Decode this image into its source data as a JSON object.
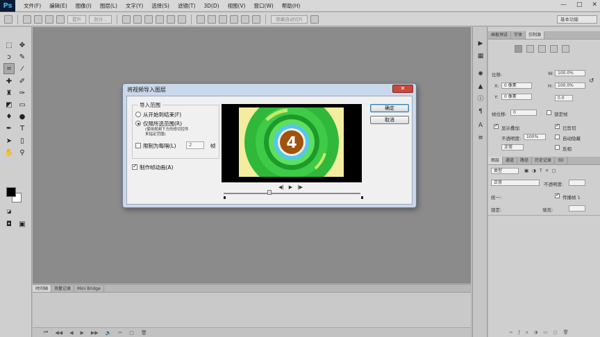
{
  "app": {
    "logo": "Ps",
    "menu": [
      "文件(F)",
      "编辑(E)",
      "图像(I)",
      "图层(L)",
      "文字(Y)",
      "选择(S)",
      "滤镜(T)",
      "3D(D)",
      "视图(V)",
      "窗口(W)",
      "帮助(H)"
    ],
    "window_controls": [
      "—",
      "□",
      "✕"
    ]
  },
  "options_bar": {
    "buttons": [
      "提升",
      "划分..."
    ],
    "auto_align_label": "隐藏自动切片",
    "workspace": "基本功能"
  },
  "timeline": {
    "tabs": [
      "时间轴",
      "测量记录",
      "Mini Bridge"
    ],
    "controls": [
      "⏮",
      "◀◀",
      "◀",
      "▶",
      "▶▶",
      "🔊",
      "✂",
      "▢",
      "🗑"
    ]
  },
  "properties_panel": {
    "tabs": [
      "画板预设",
      "字体",
      "仿制源"
    ],
    "position_label": "位移:",
    "w_label": "W:",
    "w_value": "100.0%",
    "x_label": "X:",
    "x_value": "0 像素",
    "h_label": "H:",
    "h_value": "100.0%",
    "y_label": "Y:",
    "y_value": "0 像素",
    "angle_value": "0.0",
    "frame_offset_label": "帧位移:",
    "frame_offset_value": "0",
    "lock_frame_label": "锁定帧",
    "show_overlay_label": "显示叠加",
    "clip_label": "已剪切",
    "opacity_label": "不透明度:",
    "opacity_value": "100%",
    "auto_hide_label": "自动隐藏",
    "blend_value": "正常",
    "invert_label": "反相"
  },
  "layers_panel": {
    "tabs": [
      "图层",
      "通道",
      "路径",
      "历史记录",
      "3D"
    ],
    "filter_value": "类型",
    "blend_value": "正常",
    "opacity_label": "不透明度:",
    "unify_label": "统一:",
    "propagate_label": "传播帧 1",
    "lock_label": "锁定:",
    "fill_label": "填充:"
  },
  "dialog": {
    "title": "将视频导入图层",
    "close": "✕",
    "group_label": "导入范围",
    "radio_from_start": "从开始到结束(F)",
    "radio_selected": "仅限所选范围(R)",
    "note": "(使用视频下方的修切控件\n来指定范围)",
    "limit_label": "限制为每隔(L)",
    "limit_value": "2",
    "frame_unit": "帧",
    "make_animation_label": "制作帧动画(A)",
    "ok": "确定",
    "cancel": "取消",
    "preview_number": "4",
    "playback": [
      "◀|",
      "▶",
      "|▶"
    ]
  }
}
